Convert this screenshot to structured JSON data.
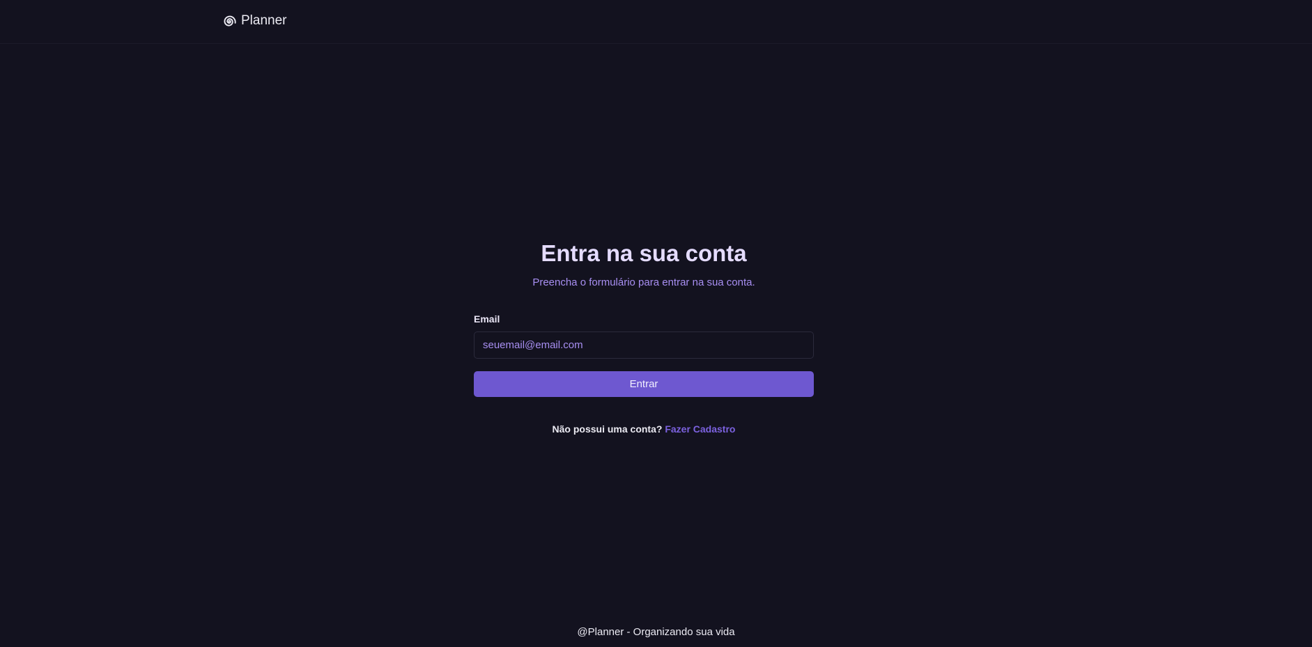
{
  "header": {
    "brand_name": "Planner",
    "brand_icon": "spiral-icon"
  },
  "login": {
    "title": "Entra na sua conta",
    "subtitle": "Preencha o formulário para entrar na sua conta.",
    "email_label": "Email",
    "email_placeholder": "seuemail@email.com",
    "email_value": "",
    "submit_label": "Entrar",
    "signup_prompt": "Não possui uma conta?",
    "signup_link": "Fazer Cadastro"
  },
  "footer": {
    "text": "@Planner - Organizando sua vida"
  },
  "colors": {
    "background": "#13121f",
    "accent": "#6e58d0",
    "link": "#7c62e0",
    "subtitle": "#a88ff2",
    "title": "#e5dcff"
  }
}
